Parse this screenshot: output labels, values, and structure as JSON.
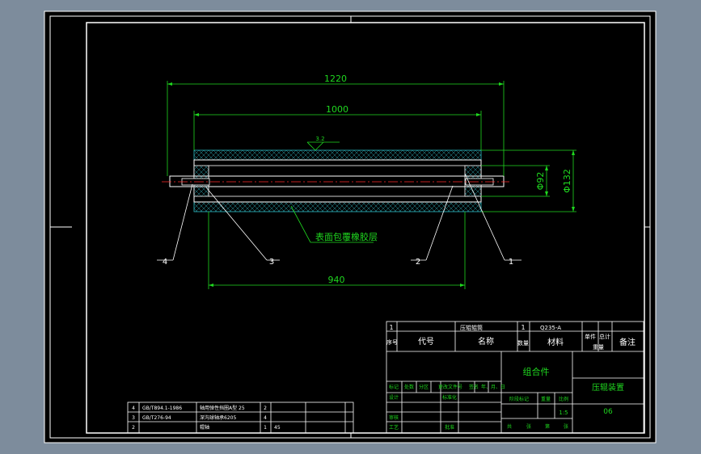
{
  "drawing": {
    "dimensions": {
      "overall_length": "1220",
      "roller_length": "1000",
      "shaft_span": "940",
      "outer_diameter": "Φ132",
      "inner_diameter": "Φ92",
      "roughness": "3.2"
    },
    "note": "表面包覆橡胶层",
    "callouts": [
      "4",
      "3",
      "2",
      "1"
    ]
  },
  "parts_list": {
    "row1": {
      "no": "1",
      "name": "压辊辊筒",
      "qty": "1",
      "material": "Q235-A"
    },
    "header": {
      "no": "序号",
      "code": "代号",
      "name": "名称",
      "qty": "数量",
      "material": "材料",
      "single": "单件",
      "total": "总计",
      "weight": "重量",
      "remark": "备注"
    }
  },
  "title_block": {
    "assembly": "组合件",
    "title": "压辊装置",
    "drawing_no": "06",
    "scale": "1:5",
    "rev_labels": [
      "标记",
      "处数",
      "分区",
      "更改文件号",
      "签名",
      "年、月、日"
    ],
    "side_labels": [
      "设计",
      "审核",
      "工艺",
      "标准化",
      "批准"
    ],
    "stage_labels": [
      "阶段标记",
      "重量",
      "比例"
    ],
    "sheet_labels": [
      "共",
      "张",
      "第",
      "张"
    ]
  },
  "small_parts": [
    {
      "no": "4",
      "code": "GB/T894.1-1986",
      "name": "轴用弹性挡圈A型 25",
      "qty": "2",
      "material": ""
    },
    {
      "no": "3",
      "code": "GB/T276-94",
      "name": "深沟球轴承6205",
      "qty": "4",
      "material": ""
    },
    {
      "no": "2",
      "code": "",
      "name": "辊轴",
      "qty": "1",
      "material": "45"
    }
  ]
}
